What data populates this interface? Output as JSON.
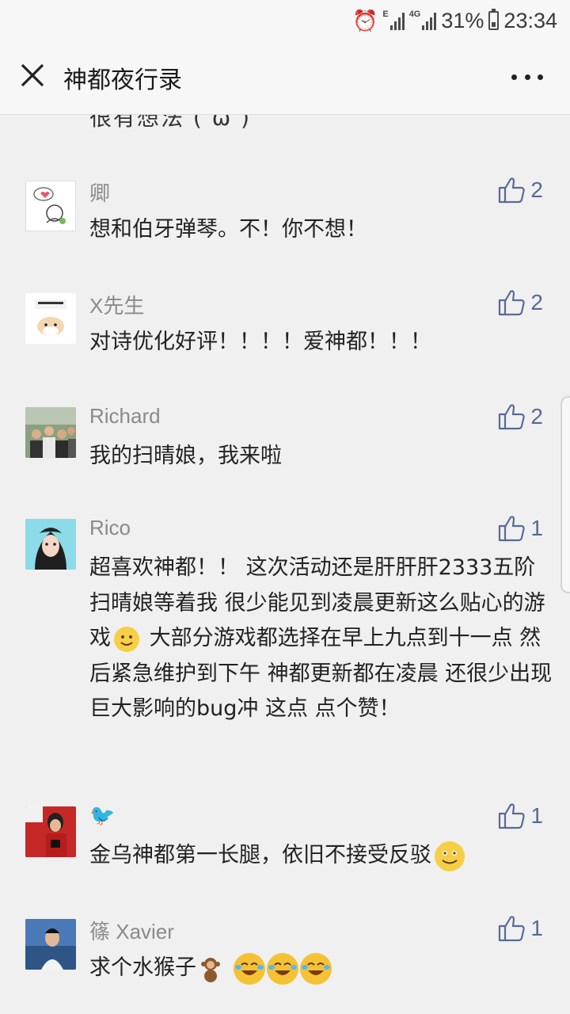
{
  "status_bar": {
    "net_tag_e": "E",
    "net_tag_4g": "4G",
    "battery": "31%",
    "time": "23:34"
  },
  "header": {
    "title": "神都夜行录",
    "close_icon": "close-icon",
    "more_icon": "more-icon"
  },
  "clipped_text": "很有想法 (  ω  )",
  "comments": [
    {
      "name": "卿",
      "text": "想和伯牙弹琴。不！你不想！",
      "likes": "2",
      "avatar": "doodle-avatar"
    },
    {
      "name": "X先生",
      "text": "对诗优化好评！！！！爱神都！！！",
      "likes": "2",
      "avatar": "hamster-avatar"
    },
    {
      "name": "Richard",
      "text": "我的扫晴娘，我来啦",
      "likes": "2",
      "avatar": "group-photo-avatar"
    },
    {
      "name": "Rico",
      "text_part1": "超喜欢神都！！  这次活动还是肝肝肝2333五阶扫晴娘等着我    很少能见到凌晨更新这么贴心的游戏",
      "text_part2": " 大部分游戏都选择在早上九点到十一点 然后紧急维护到下午   神都更新都在凌晨 还很少出现巨大影响的bug冲 这点 点个赞！",
      "likes": "1",
      "avatar": "girl-avatar"
    },
    {
      "name": "🐦",
      "text": "金乌神都第一长腿，依旧不接受反驳",
      "likes": "1",
      "avatar": "basketball-avatar"
    },
    {
      "name": "篠 Xavier",
      "text": "求个水猴子",
      "likes": "1",
      "avatar": "selfie-avatar"
    }
  ],
  "colors": {
    "link_blue": "#576b95",
    "name_gray": "#8a8a8a",
    "background": "#f0f0f0"
  }
}
